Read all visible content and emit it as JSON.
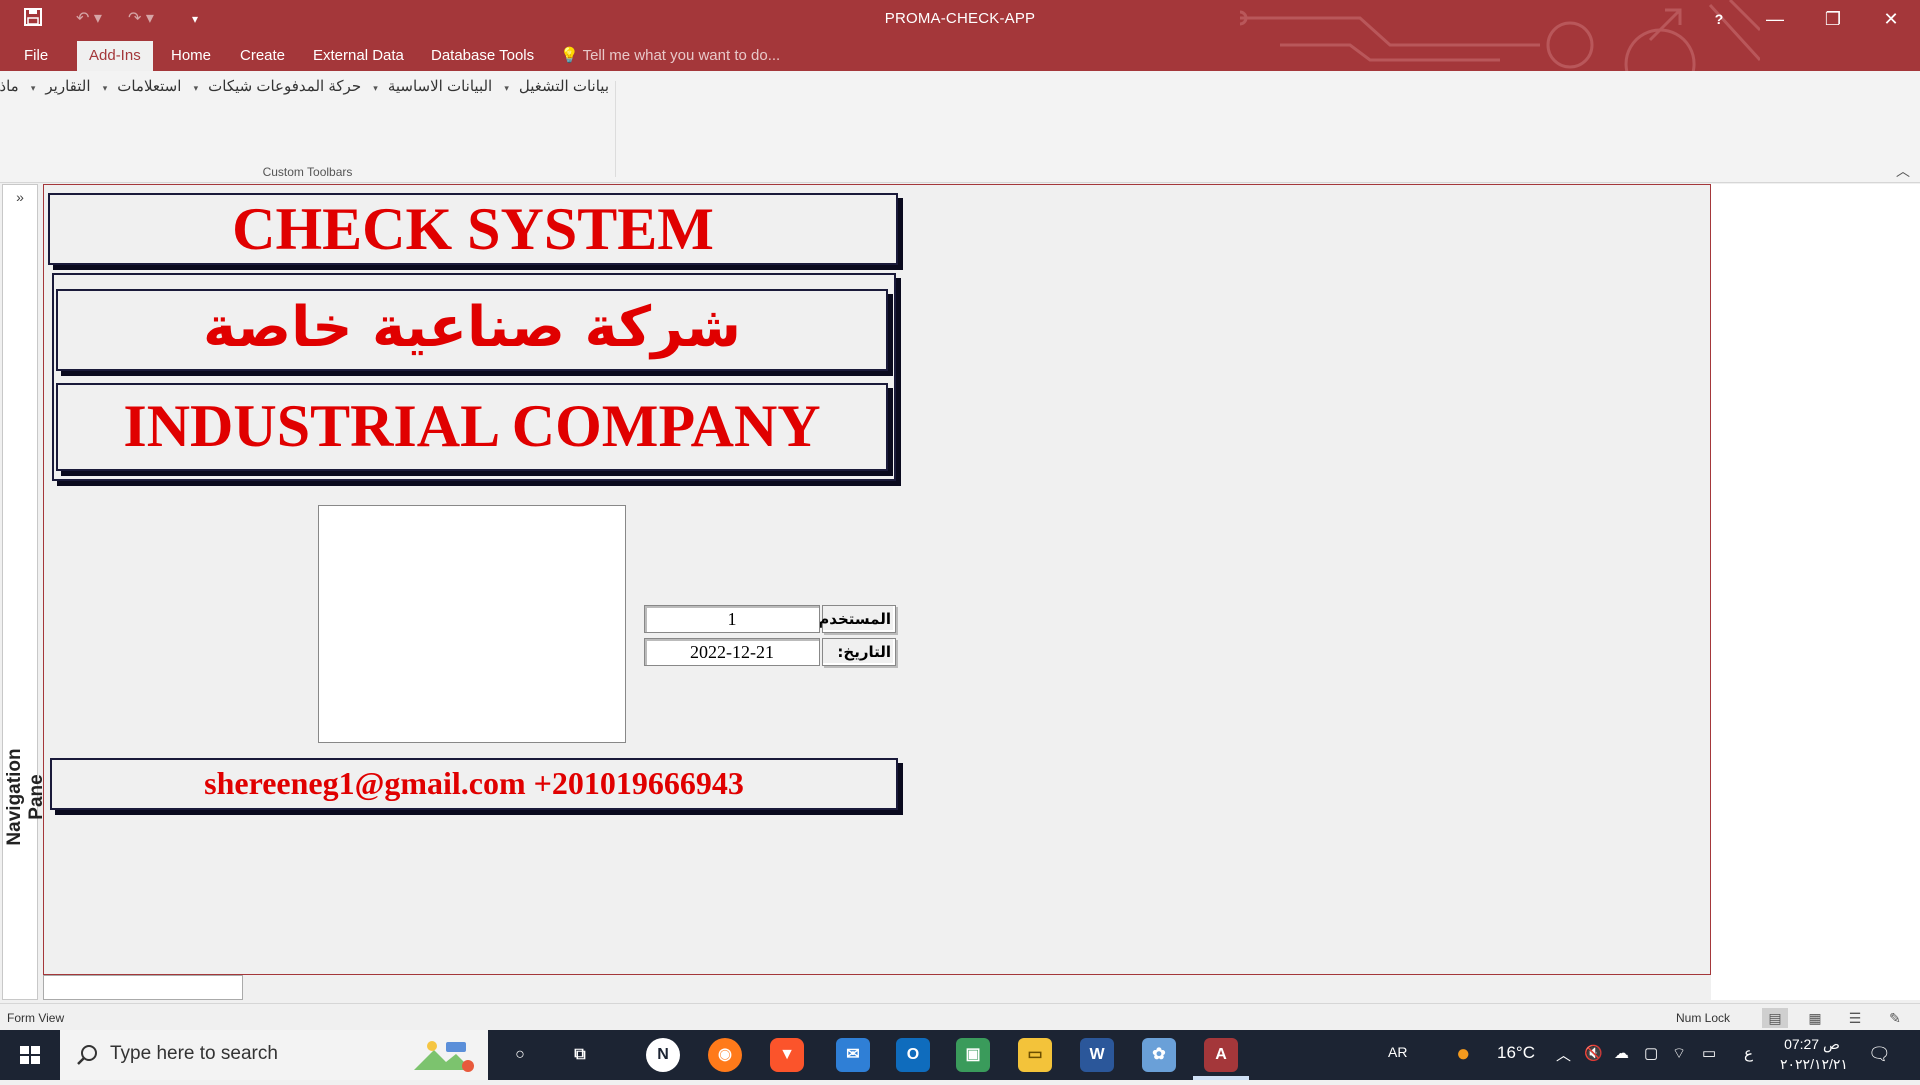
{
  "window": {
    "title": "PROMA-CHECK-APP",
    "help": "?",
    "minimize": "—",
    "restore": "❐",
    "close": "✕"
  },
  "quick_access": {
    "save_icon": "save-icon",
    "undo_icon": "undo-icon",
    "redo_icon": "redo-icon"
  },
  "tabs": [
    {
      "label": "File",
      "active": false
    },
    {
      "label": "Add-Ins",
      "active": true
    },
    {
      "label": "Home",
      "active": false
    },
    {
      "label": "Create",
      "active": false
    },
    {
      "label": "External Data",
      "active": false
    },
    {
      "label": "Database Tools",
      "active": false
    }
  ],
  "tell_me": "Tell me what you want to do...",
  "ribbon": {
    "custom_menus": [
      "بيانات التشغيل",
      "البيانات الاساسية",
      "حركة المدفوعات شيكات",
      "استعلامات",
      "التقارير",
      "ماذا عن؟"
    ],
    "group_label": "Custom Toolbars"
  },
  "navigation_pane": {
    "label": "Navigation Pane",
    "expand": "»"
  },
  "form": {
    "banner_title": "CHECK SYSTEM",
    "company_arabic": "شركة صناعية خاصة",
    "company_english": "INDUSTRIAL COMPANY",
    "user_label": "المستخدم:",
    "user_value": "1",
    "date_label": "التاريخ:",
    "date_value": "2022-12-21",
    "contact": "shereeneg1@gmail.com +201019666943"
  },
  "status_bar": {
    "mode": "Form View",
    "num_lock": "Num Lock"
  },
  "taskbar": {
    "search_placeholder": "Type here to search",
    "language": "AR",
    "temperature": "16°C",
    "time": "07:27 ص",
    "date": "٢٠٢٢/١٢/٢١",
    "keyboard_indicator": "ع"
  }
}
